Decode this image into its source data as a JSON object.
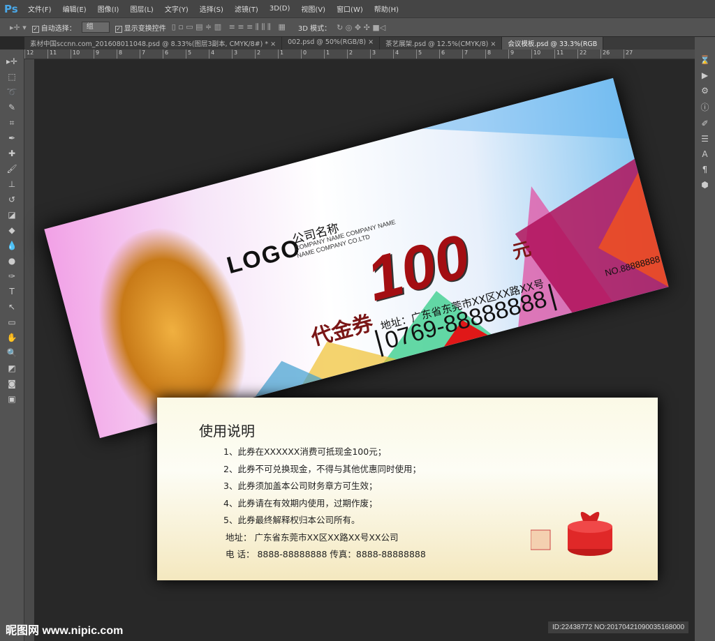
{
  "app": {
    "logo": "Ps",
    "menu": [
      "文件(F)",
      "编辑(E)",
      "图像(I)",
      "图层(L)",
      "文字(Y)",
      "选择(S)",
      "滤镜(T)",
      "3D(D)",
      "视图(V)",
      "窗口(W)",
      "帮助(H)"
    ]
  },
  "options": {
    "auto_select_label": "自动选择：",
    "auto_select_value": "组",
    "show_transform_label": "显示变换控件",
    "mode_3d_label": "3D 模式：",
    "check": "✓"
  },
  "tabs": [
    "素材中国sccnn.com_201608011048.psd @ 8.33%(图层3副本, CMYK/8#) *",
    "002.psd @ 50%(RGB/8)",
    "茶艺展架.psd @ 12.5%(CMYK/8)",
    "会议模板.psd @ 33.3%(RGB"
  ],
  "tab_close": "×",
  "ruler": [
    "12",
    "11",
    "10",
    "9",
    "8",
    "7",
    "6",
    "5",
    "4",
    "3",
    "2",
    "1",
    "0",
    "1",
    "2",
    "3",
    "4",
    "5",
    "6",
    "7",
    "8",
    "9",
    "10",
    "11",
    "22",
    "26",
    "27"
  ],
  "card1": {
    "logo": "LOGO",
    "company_cn": "公司名称",
    "company_en1": "COMPANY NAME COMPANY NAME",
    "company_en2": "NAME COMPANY CO.LTD",
    "amount": "100",
    "unit": "元",
    "voucher": "代金券",
    "address": "地址：广东省东莞市XX区XX路XX号",
    "phone": "0769-88888888",
    "serial": "NO.88888888"
  },
  "card2": {
    "title": "使用说明",
    "rules": [
      "1、此券在XXXXXX消费可抵现金100元；",
      "2、此券不可兑换现金，不得与其他优惠同时使用；",
      "3、此券须加盖本公司财务章方可生效；",
      "4、此券请在有效期内使用，过期作废；",
      "5、此券最终解释权归本公司所有。"
    ],
    "address": "地址：  广东省东莞市XX区XX路XX号XX公司",
    "contact": "电 话：  8888-88888888  传真：8888-88888888"
  },
  "watermark": {
    "site": "昵图网 www.nipic.com",
    "id": "ID:22438772 NO:20170421090035168000"
  }
}
